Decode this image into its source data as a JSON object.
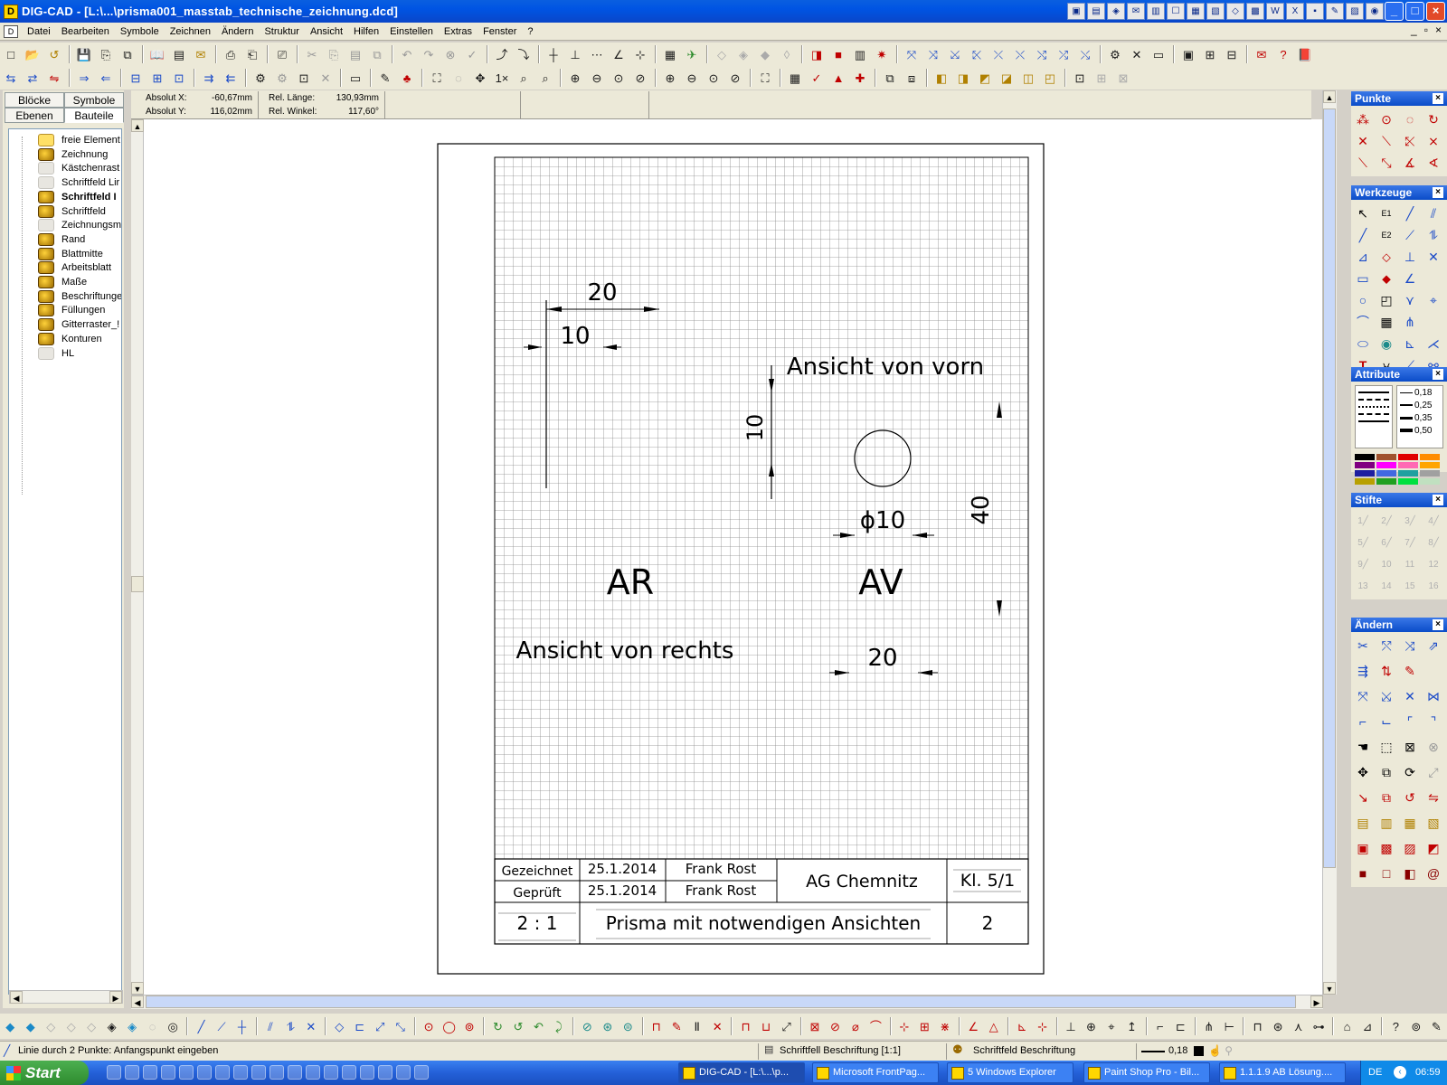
{
  "window": {
    "title": "DIG-CAD - [L:\\...\\prisma001_masstab_technische_zeichnung.dcd]",
    "tray_icons": [
      "task-icon-1",
      "task-icon-2",
      "task-icon-3",
      "task-icon-4",
      "task-icon-5",
      "task-icon-6",
      "task-icon-7",
      "task-icon-8",
      "task-icon-9",
      "task-icon-10",
      "task-icon-11",
      "task-icon-12",
      "task-icon-13",
      "task-icon-14",
      "task-icon-15",
      "task-icon-16"
    ]
  },
  "menu": {
    "items": [
      "Datei",
      "Bearbeiten",
      "Symbole",
      "Zeichnen",
      "Ändern",
      "Struktur",
      "Ansicht",
      "Hilfen",
      "Einstellen",
      "Extras",
      "Fenster",
      "?"
    ]
  },
  "left_panel": {
    "tabs": [
      "Blöcke",
      "Symbole",
      "Ebenen",
      "Bauteile"
    ],
    "tree": [
      {
        "label": "freie Element",
        "type": "folder",
        "bold": false
      },
      {
        "label": "Zeichnung",
        "type": "layer",
        "bold": false
      },
      {
        "label": "Kästchenrast",
        "type": "faint",
        "bold": false
      },
      {
        "label": "Schriftfeld Lir",
        "type": "faint",
        "bold": false
      },
      {
        "label": "Schriftfeld I",
        "type": "layer",
        "bold": true
      },
      {
        "label": "Schriftfeld",
        "type": "layer",
        "bold": false
      },
      {
        "label": "Zeichnungsmi",
        "type": "faint",
        "bold": false
      },
      {
        "label": "Rand",
        "type": "layer",
        "bold": false
      },
      {
        "label": "Blattmitte",
        "type": "layer",
        "bold": false
      },
      {
        "label": "Arbeitsblatt",
        "type": "layer",
        "bold": false
      },
      {
        "label": "Maße",
        "type": "layer",
        "bold": false
      },
      {
        "label": "Beschriftunger",
        "type": "layer",
        "bold": false
      },
      {
        "label": "Füllungen",
        "type": "layer",
        "bold": false
      },
      {
        "label": "Gitterraster_!",
        "type": "layer",
        "bold": false
      },
      {
        "label": "Konturen",
        "type": "layer",
        "bold": false
      },
      {
        "label": "HL",
        "type": "faint",
        "bold": false
      }
    ]
  },
  "coords": {
    "absolut_x_label": "Absolut X:",
    "absolut_x": "-60,67mm",
    "absolut_y_label": "Absolut Y:",
    "absolut_y": "116,02mm",
    "rel_laenge_label": "Rel. Länge:",
    "rel_laenge": "130,93mm",
    "rel_winkel_label": "Rel. Winkel:",
    "rel_winkel": "117,60°"
  },
  "drawing": {
    "dim_20_top": "20",
    "dim_10_top": "10",
    "dim_10_vert": "10",
    "dim_40": "40",
    "dim_phi10": "ϕ10",
    "dim_20_bottom": "20",
    "label_front": "Ansicht von vorn",
    "label_right": "Ansicht von rechts",
    "code_ar": "AR",
    "code_av": "AV",
    "titleblock": {
      "gezeichnet_label": "Gezeichnet",
      "gezeichnet_date": "25.1.2014",
      "gezeichnet_name": "Frank Rost",
      "geprueft_label": "Geprüft",
      "geprueft_date": "25.1.2014",
      "geprueft_name": "Frank Rost",
      "org": "AG Chemnitz",
      "class": "Kl. 5/1",
      "scale": "2 : 1",
      "title": "Prisma mit notwendigen Ansichten",
      "sheet": "2"
    }
  },
  "palettes": {
    "punkte": "Punkte",
    "werkzeuge": "Werkzeuge",
    "attribute": "Attribute",
    "line_widths": [
      "0,18",
      "0,25",
      "0,35",
      "0,50"
    ],
    "stifte": "Stifte",
    "aendern": "Ändern",
    "colors": [
      "#000000",
      "#a0522d",
      "#e00000",
      "#ff8c00",
      "#800080",
      "#ff00ff",
      "#ff69b4",
      "#ffa500",
      "#1e1ea0",
      "#4169e1",
      "#20a0a0",
      "#a0a0a0",
      "#b8a000",
      "#20a020",
      "#00e040",
      "#c0e0c0"
    ]
  },
  "status": {
    "hint": "Linie durch 2 Punkte: Anfangspunkt eingeben",
    "block": "Schriftfell Beschriftung [1:1]",
    "layer": "Schriftfeld Beschriftung",
    "linewidth": "0,18"
  },
  "taskbar": {
    "start": "Start",
    "tasks": [
      {
        "label": "DIG-CAD - [L:\\...\\p...",
        "active": true
      },
      {
        "label": "Microsoft FrontPag...",
        "active": false
      },
      {
        "label": "5 Windows Explorer",
        "active": false
      },
      {
        "label": "Paint Shop Pro - Bil...",
        "active": false
      },
      {
        "label": "1.1.1.9 AB Lösung....",
        "active": false
      }
    ],
    "lang": "DE",
    "clock": "06:59"
  }
}
